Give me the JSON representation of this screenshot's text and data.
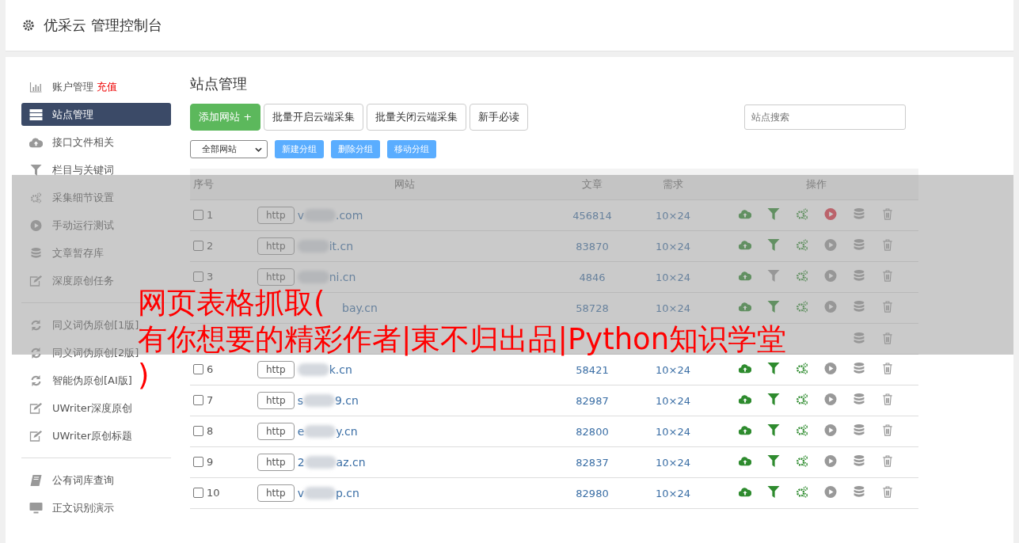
{
  "header": {
    "title": "优采云 管理控制台"
  },
  "sidebar": {
    "groups": [
      [
        {
          "label": "账户管理",
          "badge": "充值",
          "selected": false
        },
        {
          "label": "站点管理",
          "selected": true
        },
        {
          "label": "接口文件相关",
          "selected": false
        },
        {
          "label": "栏目与关键词",
          "selected": false
        },
        {
          "label": "采集细节设置",
          "selected": false
        },
        {
          "label": "手动运行测试",
          "selected": false
        },
        {
          "label": "文章暂存库",
          "selected": false
        },
        {
          "label": "深度原创任务",
          "selected": false
        }
      ],
      [
        {
          "label": "同义词伪原创[1版]",
          "selected": false
        },
        {
          "label": "同义词伪原创[2版]",
          "selected": false
        },
        {
          "label": "智能伪原创[AI版]",
          "selected": false
        },
        {
          "label": "UWriter深度原创",
          "selected": false
        },
        {
          "label": "UWriter原创标题",
          "selected": false
        }
      ],
      [
        {
          "label": "公有词库查询",
          "selected": false
        },
        {
          "label": "正文识别演示",
          "selected": false
        }
      ]
    ]
  },
  "page": {
    "title": "站点管理",
    "buttons": [
      {
        "label": "添加网站 +",
        "kind": "primary"
      },
      {
        "label": "批量开启云端采集",
        "kind": "default"
      },
      {
        "label": "批量关闭云端采集",
        "kind": "default"
      },
      {
        "label": "新手必读",
        "kind": "default"
      }
    ],
    "search": {
      "placeholder": "站点搜索"
    },
    "group_select": {
      "value": "全部网站"
    },
    "group_buttons": [
      "新建分组",
      "删除分组",
      "移动分组"
    ]
  },
  "table": {
    "columns": [
      "序号",
      "网站",
      "文章",
      "需求",
      "操作"
    ],
    "rows": [
      {
        "index": "1",
        "checked": false,
        "scheme": "http",
        "prefix": "v",
        "suffix": ".com",
        "articles": "456814",
        "demand": "10×24",
        "filter_on": true,
        "running": true
      },
      {
        "index": "2",
        "checked": false,
        "scheme": "http",
        "prefix": "",
        "suffix": "it.cn",
        "articles": "83870",
        "demand": "10×24",
        "filter_on": true,
        "running": false
      },
      {
        "index": "3",
        "checked": false,
        "scheme": "http",
        "prefix": "",
        "suffix": "ni.cn",
        "articles": "4846",
        "demand": "10×24",
        "filter_on": false,
        "running": false
      },
      {
        "prefix": "",
        "suffix": "bay.cn",
        "blur_hidden": true,
        "articles": "58728",
        "demand": "10×24",
        "filter_on": true,
        "running": false
      },
      {
        "prefix": "",
        "suffix": ""
      },
      {
        "index": "6",
        "checked": false,
        "scheme": "http",
        "prefix": "",
        "suffix": "k.cn",
        "articles": "58421",
        "demand": "10×24",
        "filter_on": true,
        "running": false
      },
      {
        "index": "7",
        "checked": false,
        "scheme": "http",
        "prefix": "s",
        "suffix": "9.cn",
        "articles": "82987",
        "demand": "10×24",
        "filter_on": true,
        "running": false
      },
      {
        "index": "8",
        "checked": false,
        "scheme": "http",
        "prefix": "e",
        "suffix": "y.cn",
        "articles": "82800",
        "demand": "10×24",
        "filter_on": true,
        "running": false
      },
      {
        "index": "9",
        "checked": false,
        "scheme": "http",
        "prefix": "2",
        "suffix": "az.cn",
        "articles": "82837",
        "demand": "10×24",
        "filter_on": true,
        "running": false
      },
      {
        "index": "10",
        "checked": false,
        "scheme": "http",
        "prefix": "v",
        "suffix": "p.cn",
        "articles": "82980",
        "demand": "10×24",
        "filter_on": true,
        "running": false
      }
    ]
  },
  "caption": {
    "lines": [
      "网页表格抓取(",
      "有你想要的精彩作者|東不归出品|Python知识学堂",
      ")"
    ]
  }
}
